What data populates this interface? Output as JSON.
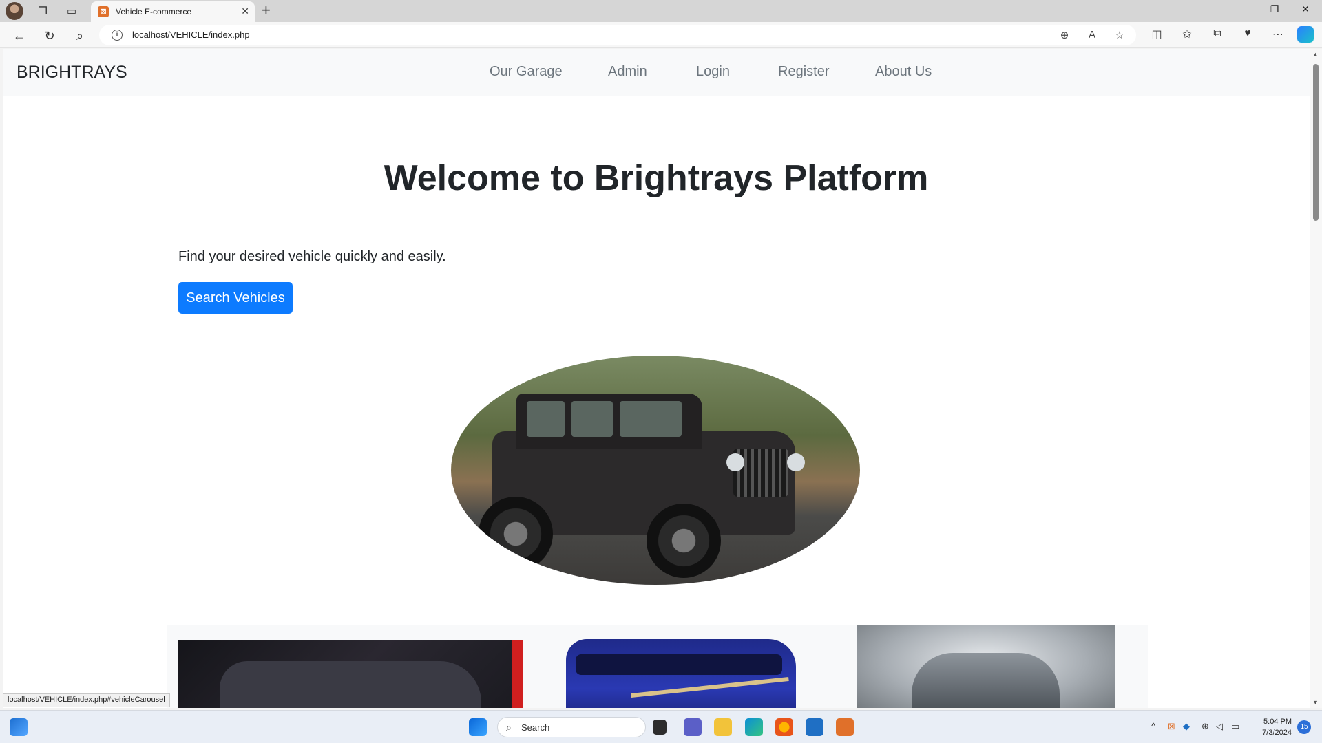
{
  "browser": {
    "tab_title": "Vehicle E-commerce",
    "url": "localhost/VEHICLE/index.php",
    "status_url": "localhost/VEHICLE/index.php#vehicleCarousel"
  },
  "site": {
    "brand": "BRIGHTRAYS",
    "nav": [
      "Our Garage",
      "Admin",
      "Login",
      "Register",
      "About Us"
    ],
    "hero_title": "Welcome to Brightrays Platform",
    "lead": "Find your desired vehicle quickly and easily.",
    "search_button": "Search Vehicles"
  },
  "taskbar": {
    "search_placeholder": "Search",
    "time": "5:04 PM",
    "date": "7/3/2024",
    "notification_count": "15"
  },
  "colors": {
    "primary": "#0d7bff",
    "navbar_bg": "#f8f9fa",
    "nav_link": "#6c757d"
  }
}
